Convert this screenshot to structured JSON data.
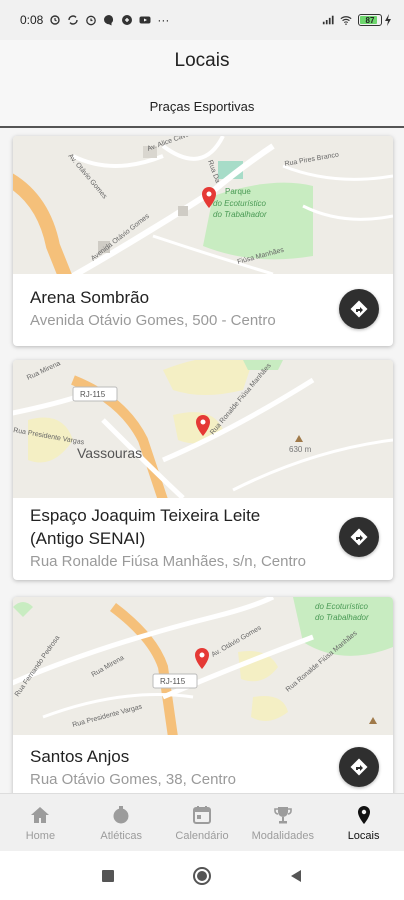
{
  "status_bar": {
    "time": "0:08",
    "left_icons": [
      "alarm-icon",
      "sync-icon",
      "clock-icon",
      "messenger-icon",
      "vpn-icon",
      "youtube-icon"
    ],
    "more": "···",
    "battery_level": "87"
  },
  "header": {
    "title": "Locais",
    "subtitle": "Praças Esportivas"
  },
  "cards": [
    {
      "title_line1": "Arena Sombrão",
      "title_line2": "",
      "address": "Avenida Otávio Gomes, 500 - Centro",
      "map_labels": {
        "park": "Parque",
        "park2": "do Ecoturístico",
        "park3": "do Trabalhador",
        "street1": "Avenida Otávio Gomes",
        "street2": "Rua Pires Branco",
        "street3": "Fiúsa Manhães",
        "street4": "Av. Otávio Gomes",
        "street5": "Av. Alice Caval",
        "street6": "Rua Da"
      }
    },
    {
      "title_line1": "Espaço Joaquim Teixeira Leite",
      "title_line2": "(Antigo SENAI)",
      "address": "Rua Ronalde Fiúsa Manhães, s/n, Centro",
      "map_labels": {
        "city": "Vassouras",
        "highway": "RJ-115",
        "elevation": "630 m",
        "street1": "Rua Mirena",
        "street2": "Rua Presidente Vargas",
        "street3": "Rua Ronalde Fiúsa Manhães"
      }
    },
    {
      "title_line1": "Santos Anjos",
      "title_line2": "",
      "address": "Rua Otávio Gomes, 38, Centro",
      "map_labels": {
        "park2": "do Ecoturístico",
        "park3": "do Trabalhador",
        "highway": "RJ-115",
        "street1": "Rua Fernando Pedrosa",
        "street2": "Rua Mirena",
        "street3": "Rua Presidente Vargas",
        "street4": "Av. Otávio Gomes",
        "street5": "Rua Ronalde Fiúsa Manhães"
      }
    }
  ],
  "bottom_nav": [
    {
      "label": "Home",
      "icon": "home-icon",
      "active": false
    },
    {
      "label": "Atléticas",
      "icon": "ball-icon",
      "active": false
    },
    {
      "label": "Calendário",
      "icon": "calendar-icon",
      "active": false
    },
    {
      "label": "Modalidades",
      "icon": "trophy-icon",
      "active": false
    },
    {
      "label": "Locais",
      "icon": "location-pin-icon",
      "active": true
    }
  ],
  "colors": {
    "map_bg": "#eeece6",
    "road_orange": "#f5c07a",
    "park_green": "#c8ecc1",
    "pin_red": "#e53935",
    "button_dark": "#2f2f2f"
  }
}
